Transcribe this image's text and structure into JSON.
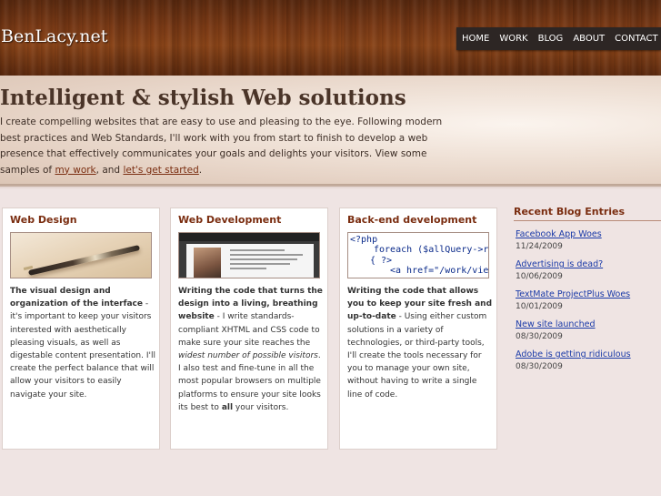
{
  "site": {
    "logo": "BenLacy.net"
  },
  "nav": {
    "items": [
      "HOME",
      "WORK",
      "BLOG",
      "ABOUT",
      "CONTACT"
    ]
  },
  "hero": {
    "title": "Intelligent & stylish Web solutions",
    "text_before": "I create compelling websites that are easy to use and pleasing to the eye. Following modern best practices and Web Standards, I'll work with you from start to finish to develop a web presence that effectively communicates your goals and delights your visitors. View some samples of ",
    "link_work": "my work",
    "text_mid": ", and ",
    "link_start": "let's get started",
    "text_end": "."
  },
  "columns": [
    {
      "title": "Web Design",
      "bold": "The visual design and organization of the interface",
      "text": " - it's important to keep your visitors interested with aesthetically pleasing visuals, as well as digestable content presentation. I'll create the perfect balance that will allow your visitors to easily navigate your site."
    },
    {
      "title": "Web Development",
      "bold": "Writing the code that turns the design into a living, breathing website",
      "text1": " - I write standards-compliant XHTML and CSS code to make sure your site reaches the ",
      "italic": "widest number of possible visitors",
      "text2": ". I also test and fine-tune in all the most popular browsers on multiple platforms to ensure your site looks its best to ",
      "bold2": "all",
      "text3": " your visitors."
    },
    {
      "title": "Back-end development",
      "bold": "Writing the code that allows you to keep your site fresh and up-to-date",
      "text": " - Using either custom solutions in a variety of technologies, or third-party tools, I'll create the tools necessary for you to manage your own site, without having to write a single line of code.",
      "code_lines": [
        "<?php",
        "foreach ($allQuery->res",
        "{ ?>",
        "<a href=\"/work/view."
      ]
    }
  ],
  "sidebar": {
    "title": "Recent Blog Entries",
    "entries": [
      {
        "title": "Facebook App Woes",
        "date": "11/24/2009"
      },
      {
        "title": "Advertising is dead?",
        "date": "10/06/2009"
      },
      {
        "title": "TextMate ProjectPlus Woes",
        "date": "10/01/2009"
      },
      {
        "title": "New site launched",
        "date": "08/30/2009"
      },
      {
        "title": "Adobe is getting ridiculous",
        "date": "08/30/2009"
      }
    ]
  }
}
